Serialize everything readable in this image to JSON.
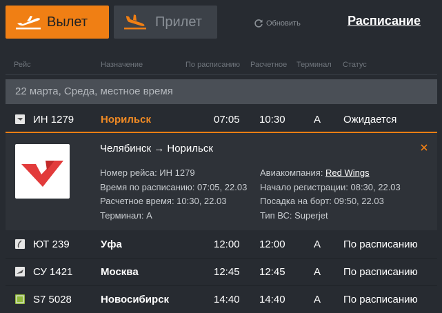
{
  "tabs": {
    "departure_label": "Вылет",
    "arrival_label": "Прилет",
    "refresh_label": "Обновить",
    "schedule_label": "Расписание"
  },
  "columns": [
    "Рейс",
    "Назначение",
    "По расписанию",
    "Расчетное",
    "Терминал",
    "Статус"
  ],
  "date_label": "22 марта, Среда, местное время",
  "flights": [
    {
      "flight": "ИН 1279",
      "destination": "Норильск",
      "scheduled": "07:05",
      "estimated": "10:30",
      "terminal": "A",
      "status": "Ожидается"
    },
    {
      "flight": "ЮТ 239",
      "destination": "Уфа",
      "scheduled": "12:00",
      "estimated": "12:00",
      "terminal": "A",
      "status": "По расписанию"
    },
    {
      "flight": "СУ 1421",
      "destination": "Москва",
      "scheduled": "12:45",
      "estimated": "12:45",
      "terminal": "A",
      "status": "По расписанию"
    },
    {
      "flight": "S7 5028",
      "destination": "Новосибирск",
      "scheduled": "14:40",
      "estimated": "14:40",
      "terminal": "A",
      "status": "По расписанию"
    }
  ],
  "detail": {
    "route": "Челябинск → Норильск",
    "flight_number": "Номер рейса: ИН 1279",
    "scheduled_time": "Время по расписанию: 07:05, 22.03",
    "estimated_time": "Расчетное время: 10:30, 22.03",
    "terminal": "Терминал: A",
    "airline_prefix": "Авиакомпания: ",
    "airline_name": "Red Wings",
    "checkin_start": "Начало регистрации: 08:30, 22.03",
    "boarding": "Посадка на борт: 09:50, 22.03",
    "aircraft_type": "Тип ВС: Superjet"
  },
  "colors": {
    "accent": "#f07f14",
    "background": "#272b31",
    "date_bar": "#4a4f56",
    "airline_brand": "#e23b3b"
  }
}
